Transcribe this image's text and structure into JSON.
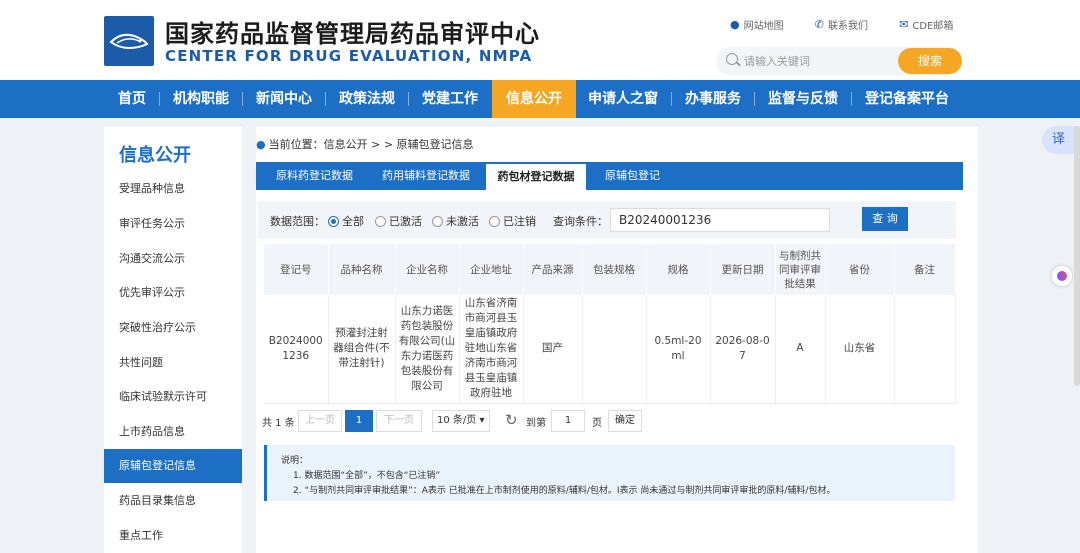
{
  "header": {
    "title_cn": "国家药品监督管理局药品审评中心",
    "title_en": "CENTER FOR DRUG EVALUATION, NMPA",
    "links": {
      "sitemap": "网站地图",
      "contact": "联系我们",
      "mail": "CDE邮箱"
    },
    "search_placeholder": "请输入关键词",
    "search_button": "搜索"
  },
  "nav": [
    "首页",
    "机构职能",
    "新闻中心",
    "政策法规",
    "党建工作",
    "信息公开",
    "申请人之窗",
    "办事服务",
    "监督与反馈",
    "登记备案平台"
  ],
  "sidebar": {
    "title": "信息公开",
    "items": [
      "受理品种信息",
      "审评任务公示",
      "沟通交流公示",
      "优先审评公示",
      "突破性治疗公示",
      "共性问题",
      "临床试验默示许可",
      "上市药品信息",
      "原辅包登记信息",
      "药品目录集信息",
      "重点工作"
    ]
  },
  "breadcrumb": {
    "prefix": "当前位置：",
    "path": "信息公开 > > 原辅包登记信息"
  },
  "tabs": [
    "原料药登记数据",
    "药用辅料登记数据",
    "药包材登记数据",
    "原辅包登记"
  ],
  "filter": {
    "range_label": "数据范围：",
    "options": [
      "全部",
      "已激活",
      "未激活",
      "已注销"
    ],
    "query_label": "查询条件：",
    "query_value": "B20240001236",
    "query_button": "查 询"
  },
  "table": {
    "headers": [
      "登记号",
      "品种名称",
      "企业名称",
      "企业地址",
      "产品来源",
      "包装规格",
      "规格",
      "更新日期",
      "与制剂共同审评审批结果",
      "省份",
      "备注"
    ],
    "rows": [
      [
        "B20240001236",
        "预灌封注射器组合件(不带注射针)",
        "山东力诺医药包装股份有限公司(山东力诺医药包装股份有限公司",
        "山东省济南市商河县玉皇庙镇政府驻地山东省济南市商河县玉皇庙镇政府驻地",
        "国产",
        "",
        "0.5ml-20ml",
        "2026-08-07",
        "A",
        "山东省",
        ""
      ]
    ]
  },
  "pager": {
    "total": "共 1 条",
    "prev": "上一页",
    "page": "1",
    "next": "下一页",
    "per_page": "10 条/页 ▾",
    "goto": "到第",
    "goto_value": "1",
    "unit": "页",
    "confirm": "确定"
  },
  "notice": {
    "title": "说明：",
    "line1": "1. 数据范围“全部”，不包含“已注销”",
    "line2": "2. “与制剂共同审评审批结果”：A表示 已批准在上市制剂使用的原料/辅料/包材。I表示 尚未通过与制剂共同审评审批的原料/辅料/包材。"
  },
  "float_translate": "译"
}
